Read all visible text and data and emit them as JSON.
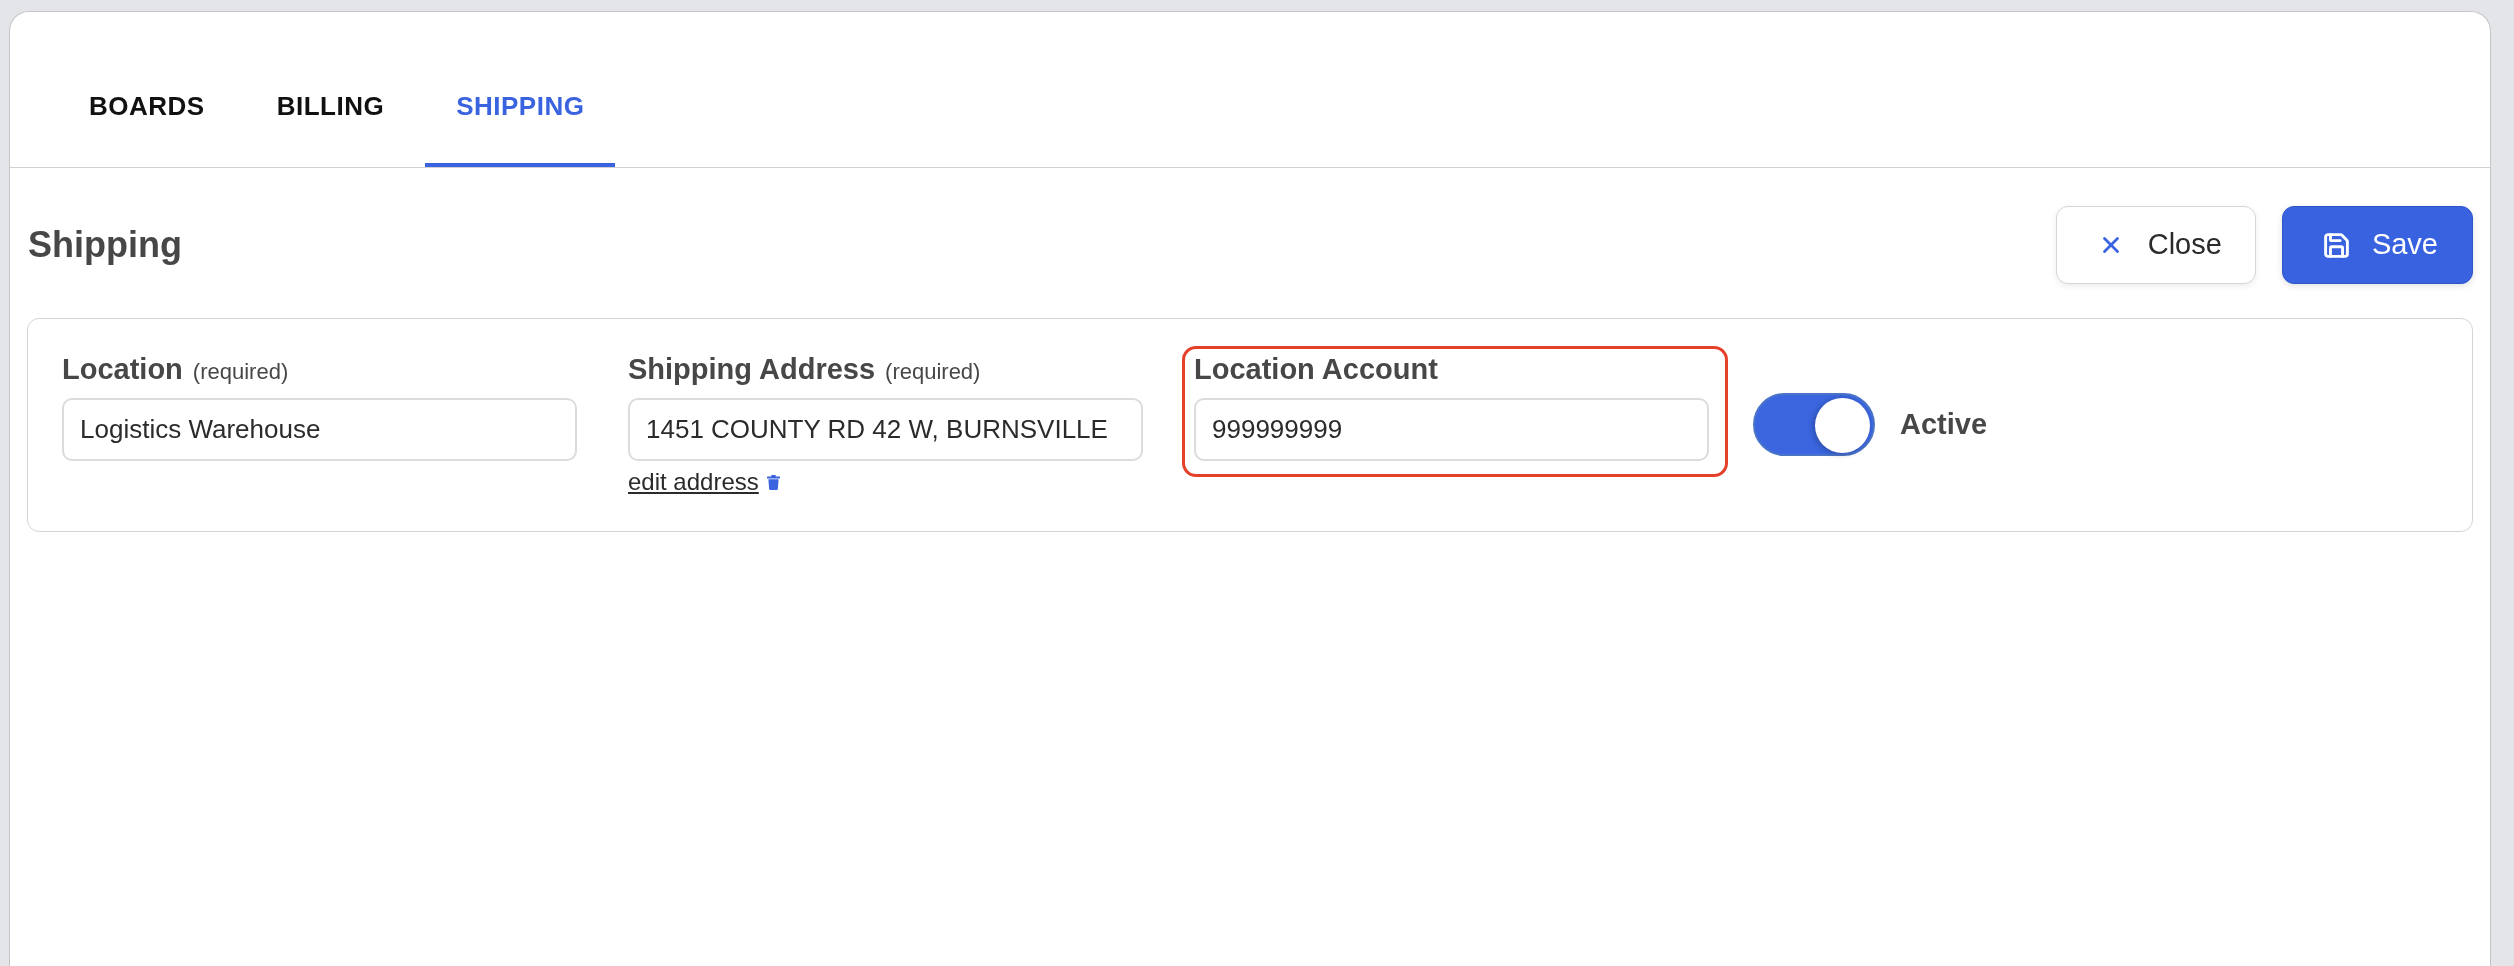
{
  "tabs": [
    {
      "label": "BOARDS",
      "selected": false
    },
    {
      "label": "BILLING",
      "selected": false
    },
    {
      "label": "SHIPPING",
      "selected": true
    }
  ],
  "section": {
    "title": "Shipping",
    "buttons": [
      {
        "kind": "secondary",
        "label": "Close"
      },
      {
        "kind": "primary",
        "label": "Save"
      }
    ]
  },
  "form": {
    "fields": [
      {
        "label": "Location",
        "note": "(required)",
        "value": "Logistics Warehouse",
        "highlighted": false
      },
      {
        "label": "Shipping Address",
        "note": "(required)",
        "value": "1451 COUNTY RD 42 W, BURNSVILLE",
        "link": "edit address",
        "highlighted": false
      },
      {
        "label": "Location Account",
        "value": "999999999",
        "highlighted": true
      }
    ],
    "toggle": {
      "label": "Active",
      "on": true
    }
  }
}
